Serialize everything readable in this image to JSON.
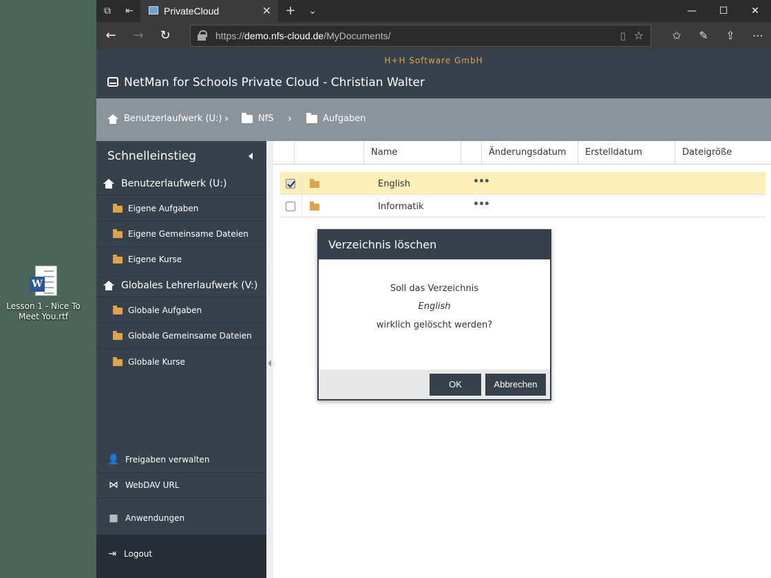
{
  "desktop": {
    "icon_label": "Lesson 1 - Nice To Meet You.rtf"
  },
  "browser": {
    "tab_title": "PrivateCloud",
    "url_prefix": "https://",
    "url_host": "demo.nfs-cloud.de",
    "url_path": "/MyDocuments/"
  },
  "app": {
    "company": "H+H Software GmbH",
    "title": "NetMan for Schools Private Cloud - Christian Walter",
    "accent_color": "#e0a24a",
    "header_color": "#36414b"
  },
  "breadcrumb": [
    "Benutzerlaufwerk (U:)",
    "NfS",
    "Aufgaben"
  ],
  "sidebar": {
    "title": "Schnelleinstieg",
    "drive1": {
      "label": "Benutzerlaufwerk (U:)",
      "folders": [
        "Eigene Aufgaben",
        "Eigene Gemeinsame Dateien",
        "Eigene Kurse"
      ]
    },
    "drive2": {
      "label": "Globales Lehrerlaufwerk (V:)",
      "folders": [
        "Globale Aufgaben",
        "Globale Gemeinsame Dateien",
        "Globale Kurse"
      ]
    },
    "bottom": [
      "Freigaben verwalten",
      "WebDAV URL",
      "Anwendungen"
    ],
    "logout": "Logout"
  },
  "table": {
    "headers": [
      "Name",
      "Änderungsdatum",
      "Erstelldatum",
      "Dateigröße"
    ],
    "rows": [
      {
        "name": "English",
        "selected": true,
        "more": "•••"
      },
      {
        "name": "Informatik",
        "selected": false,
        "more": "•••"
      }
    ]
  },
  "dialog": {
    "title": "Verzeichnis löschen",
    "line1": "Soll das Verzeichnis",
    "name": "English",
    "line3": "wirklich gelöscht werden?",
    "ok": "OK",
    "cancel": "Abbrechen"
  }
}
